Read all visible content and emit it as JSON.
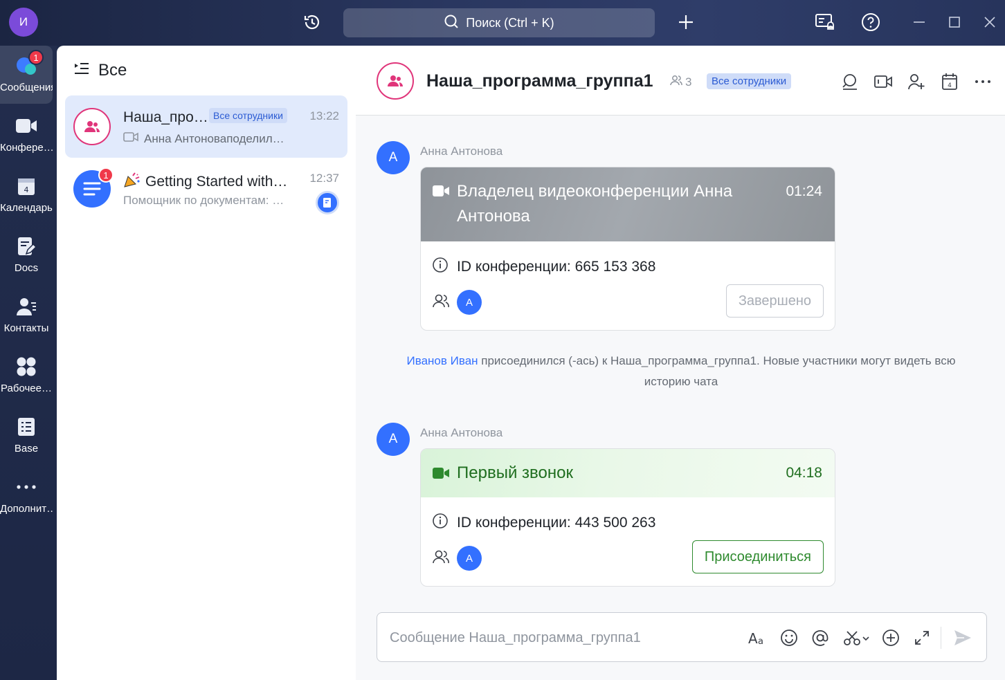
{
  "topbar": {
    "avatar_letter": "И",
    "search_placeholder": "Поиск (Ctrl + K)",
    "icons": [
      "history-icon",
      "add-icon",
      "meeting-notify-icon",
      "help-icon",
      "minimize-icon",
      "maximize-icon",
      "close-icon"
    ]
  },
  "nav": {
    "items": [
      {
        "label": "Сообщения",
        "icon": "messages-icon",
        "badge": "1",
        "active": true
      },
      {
        "label": "Конфере…",
        "icon": "video-icon"
      },
      {
        "label": "Календарь",
        "icon": "calendar-icon"
      },
      {
        "label": "Docs",
        "icon": "docs-icon"
      },
      {
        "label": "Контакты",
        "icon": "contacts-icon"
      },
      {
        "label": "Рабочее…",
        "icon": "workspace-icon"
      },
      {
        "label": "Base",
        "icon": "base-icon"
      },
      {
        "label": "Дополнит…",
        "icon": "more-icon"
      }
    ]
  },
  "chatlist": {
    "header": "Все",
    "chats": [
      {
        "title": "Наша_про…",
        "tag": "Все сотрудники",
        "time": "13:22",
        "preview": "Анна Антоноваподелил…"
      },
      {
        "title": "Getting Started with…",
        "badge": "1",
        "time": "12:37",
        "preview": "Помощник по документам: …"
      }
    ]
  },
  "main": {
    "title": "Наша_программа_группа1",
    "member_count": "3",
    "tag": "Все сотрудники",
    "messages": [
      {
        "avatar": "A",
        "sender": "Анна Антонова",
        "card_title": "Владелец видеоконференции Анна Антонова",
        "duration": "01:24",
        "conf_id": "ID конференции: 665 153 368",
        "participant": "A",
        "button": "Завершено"
      },
      {
        "avatar": "A",
        "sender": "Анна Антонова",
        "card_title": "Первый звонок",
        "duration": "04:18",
        "conf_id": "ID конференции: 443 500 263",
        "participant": "A",
        "button": "Присоединиться"
      }
    ],
    "system": {
      "name": "Иванов Иван",
      "text": " присоединился (-ась) к Наша_программа_группа1. Новые участники могут видеть всю историю чата"
    },
    "composer_placeholder": "Сообщение Наша_программа_группа1"
  },
  "colors": {
    "accent": "#3370ff",
    "green": "#2e8a2e",
    "pink": "#e0357a",
    "badge": "#f0394a"
  }
}
